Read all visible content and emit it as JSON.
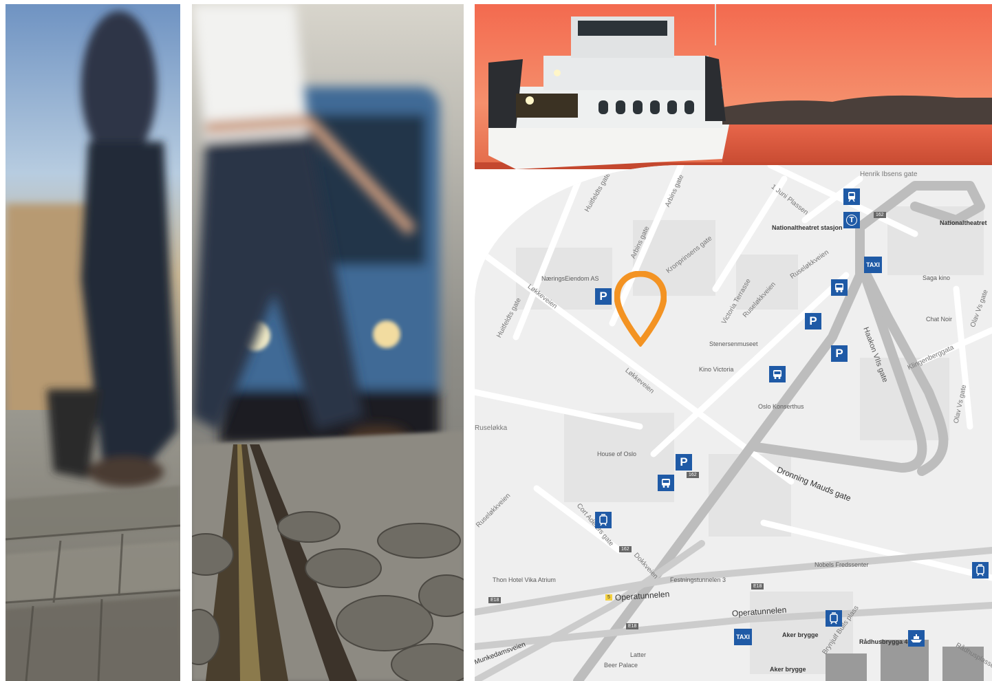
{
  "colors": {
    "accent_blue": "#1f5aa6",
    "pin_orange": "#f39323",
    "map_bg": "#efefef",
    "sunset": "#f0775a"
  },
  "photos": {
    "pedestrians": {
      "icon": "walking-people-photo"
    },
    "tram": {
      "icon": "tram-tracks-photo"
    },
    "ferry": {
      "icon": "ferry-sunset-photo"
    }
  },
  "map": {
    "pin": {
      "icon": "location-pin-icon"
    },
    "places": [
      {
        "label": "NæringsEiendom AS"
      },
      {
        "label": "Nationaltheatret stasjon"
      },
      {
        "label": "Nationaltheatret"
      },
      {
        "label": "Saga kino"
      },
      {
        "label": "Chat Noir"
      },
      {
        "label": "Stenersenmuseet"
      },
      {
        "label": "Kino Victoria"
      },
      {
        "label": "Oslo Konserthus"
      },
      {
        "label": "House of Oslo"
      },
      {
        "label": "Thon Hotel Vika Atrium"
      },
      {
        "label": "Festningstunnelen 3"
      },
      {
        "label": "Nobels Fredssenter"
      },
      {
        "label": "Aker brygge"
      },
      {
        "label": "Rådhusbrygga 4"
      },
      {
        "label": "Aker brygge"
      },
      {
        "label": "Latter"
      },
      {
        "label": "Beer Palace"
      }
    ],
    "roads": [
      {
        "label": "Henrik Ibsens gate"
      },
      {
        "label": "Huitfeldts gate"
      },
      {
        "label": "Arbins gate"
      },
      {
        "label": "Arbins gate"
      },
      {
        "label": "1 Juni Plassen"
      },
      {
        "label": "Kronprinsens gate"
      },
      {
        "label": "Løkkeveien"
      },
      {
        "label": "Huitfeldts gate"
      },
      {
        "label": "Victoria Terrasse"
      },
      {
        "label": "Ruseløkkveien"
      },
      {
        "label": "Ruseløkkveien"
      },
      {
        "label": "Løkkeveien"
      },
      {
        "label": "Haakon VIIs gate"
      },
      {
        "label": "Klingenberggata"
      },
      {
        "label": "Olav Vs gate"
      },
      {
        "label": "Olav Vs gate"
      },
      {
        "label": "Ruseløkka"
      },
      {
        "label": "Ruseløkkveien"
      },
      {
        "label": "Cort Adelers gate"
      },
      {
        "label": "Dokkveien"
      },
      {
        "label": "Dronning Mauds gate"
      },
      {
        "label": "Operatunnelen"
      },
      {
        "label": "Operatunnelen"
      },
      {
        "label": "Munkedamsveien"
      },
      {
        "label": "Brynjulf Bulls plass"
      },
      {
        "label": "Rådhusplassen"
      }
    ],
    "route_shields": {
      "r162": "162",
      "e18": "E18",
      "r5": "5"
    },
    "badges": {
      "parking": "P",
      "taxi": "TAXI",
      "train_icon": "train-icon",
      "metro": "T",
      "bus_icon": "bus-icon",
      "tram_icon": "tram-icon",
      "ferry_icon": "ferry-icon"
    }
  }
}
